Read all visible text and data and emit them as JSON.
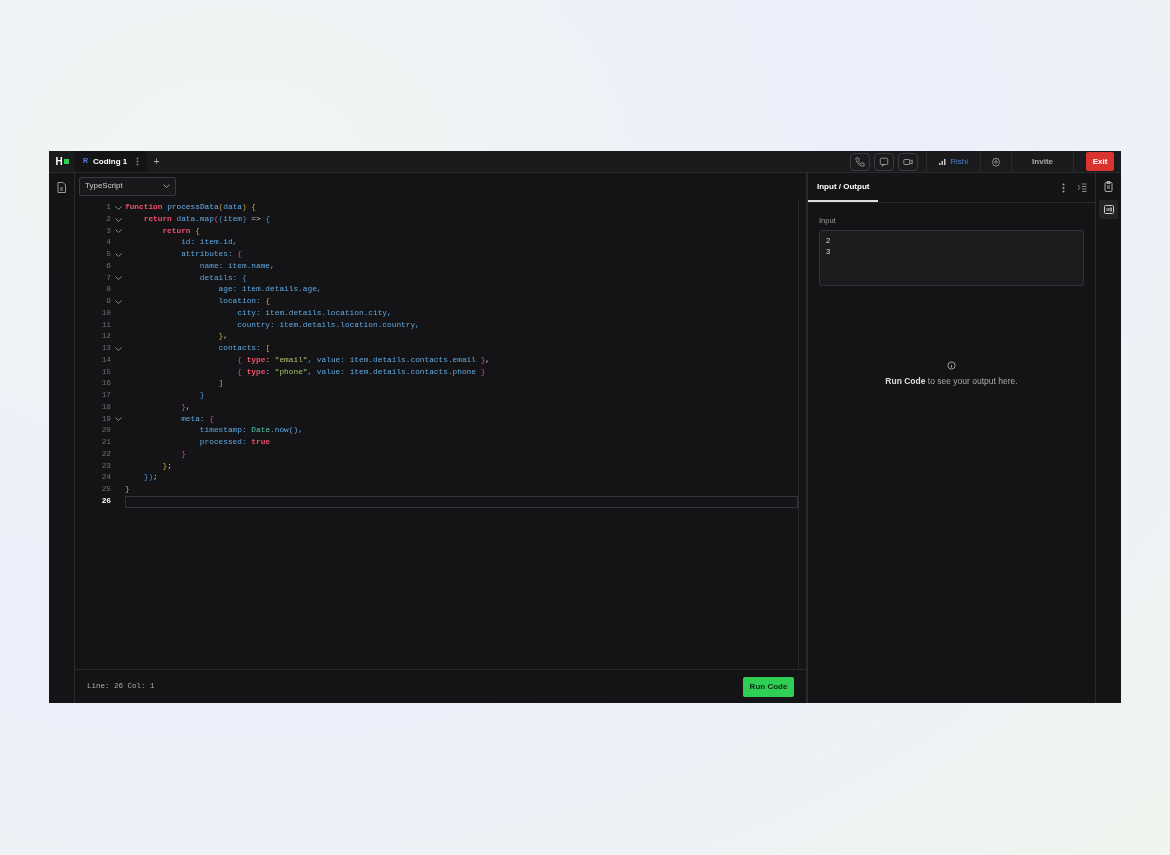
{
  "top_bar": {
    "logo": "H",
    "tabs": [
      {
        "badge": "R",
        "label": "Coding 1",
        "selected": true
      }
    ],
    "add_tab": "+",
    "user": "Rishi",
    "invite": "Invite",
    "exit": "Exit"
  },
  "editor": {
    "language": "TypeScript",
    "lines": [
      {
        "n": "1",
        "fold": true,
        "current": false,
        "seg": [
          {
            "text": "function ",
            "kind": "k"
          },
          {
            "text": "processData",
            "kind": "f"
          },
          {
            "text": "(",
            "kind": "y"
          },
          {
            "text": "data",
            "kind": "i"
          },
          {
            "text": ") {",
            "kind": "y"
          }
        ]
      },
      {
        "n": "2",
        "fold": true,
        "current": false,
        "seg": [
          {
            "text": "    return ",
            "kind": "k"
          },
          {
            "text": "data.map",
            "kind": "i"
          },
          {
            "text": "(",
            "kind": "m"
          },
          {
            "text": "(",
            "kind": "b"
          },
          {
            "text": "item",
            "kind": "i"
          },
          {
            "text": ")",
            "kind": "b"
          },
          {
            "text": " => ",
            "kind": "p"
          },
          {
            "text": "{",
            "kind": "b"
          }
        ]
      },
      {
        "n": "3",
        "fold": true,
        "current": false,
        "seg": [
          {
            "text": "        return ",
            "kind": "k"
          },
          {
            "text": "{",
            "kind": "y"
          }
        ]
      },
      {
        "n": "4",
        "fold": false,
        "current": false,
        "seg": [
          {
            "text": "            id: item.id,",
            "kind": "i"
          }
        ]
      },
      {
        "n": "5",
        "fold": true,
        "current": false,
        "seg": [
          {
            "text": "            attributes: ",
            "kind": "i"
          },
          {
            "text": "{",
            "kind": "m"
          }
        ]
      },
      {
        "n": "6",
        "fold": false,
        "current": false,
        "seg": [
          {
            "text": "                name: item.name,",
            "kind": "i"
          }
        ]
      },
      {
        "n": "7",
        "fold": true,
        "current": false,
        "seg": [
          {
            "text": "                details: ",
            "kind": "i"
          },
          {
            "text": "{",
            "kind": "b"
          }
        ]
      },
      {
        "n": "8",
        "fold": false,
        "current": false,
        "seg": [
          {
            "text": "                    age: item.details.age,",
            "kind": "i"
          }
        ]
      },
      {
        "n": "9",
        "fold": true,
        "current": false,
        "seg": [
          {
            "text": "                    location: ",
            "kind": "i"
          },
          {
            "text": "{",
            "kind": "y"
          }
        ]
      },
      {
        "n": "10",
        "fold": false,
        "current": false,
        "seg": [
          {
            "text": "                        city: item.details.location.city,",
            "kind": "i"
          }
        ]
      },
      {
        "n": "11",
        "fold": false,
        "current": false,
        "seg": [
          {
            "text": "                        country: item.details.location.country,",
            "kind": "i"
          }
        ]
      },
      {
        "n": "12",
        "fold": false,
        "current": false,
        "seg": [
          {
            "text": "                    }",
            "kind": "y"
          },
          {
            "text": ",",
            "kind": "p"
          }
        ]
      },
      {
        "n": "13",
        "fold": true,
        "current": false,
        "seg": [
          {
            "text": "                    contacts: ",
            "kind": "i"
          },
          {
            "text": "[",
            "kind": "y"
          }
        ]
      },
      {
        "n": "14",
        "fold": false,
        "current": false,
        "seg": [
          {
            "text": "                        {",
            "kind": "m"
          },
          {
            "text": " type",
            "kind": "k"
          },
          {
            "text": ": ",
            "kind": "p"
          },
          {
            "text": "\"email\"",
            "kind": "s"
          },
          {
            "text": ", value: item.details.contacts.email ",
            "kind": "i"
          },
          {
            "text": "}",
            "kind": "m"
          },
          {
            "text": ",",
            "kind": "p"
          }
        ]
      },
      {
        "n": "15",
        "fold": false,
        "current": false,
        "seg": [
          {
            "text": "                        {",
            "kind": "m"
          },
          {
            "text": " type",
            "kind": "k"
          },
          {
            "text": ": ",
            "kind": "p"
          },
          {
            "text": "\"phone\"",
            "kind": "s"
          },
          {
            "text": ", value: item.details.contacts.phone ",
            "kind": "i"
          },
          {
            "text": "}",
            "kind": "m"
          }
        ]
      },
      {
        "n": "16",
        "fold": false,
        "current": false,
        "seg": [
          {
            "text": "                    ]",
            "kind": "y"
          }
        ]
      },
      {
        "n": "17",
        "fold": false,
        "current": false,
        "seg": [
          {
            "text": "                }",
            "kind": "b"
          }
        ]
      },
      {
        "n": "18",
        "fold": false,
        "current": false,
        "seg": [
          {
            "text": "            }",
            "kind": "m"
          },
          {
            "text": ",",
            "kind": "p"
          }
        ]
      },
      {
        "n": "19",
        "fold": true,
        "current": false,
        "seg": [
          {
            "text": "            meta: ",
            "kind": "i"
          },
          {
            "text": "{",
            "kind": "m"
          }
        ]
      },
      {
        "n": "20",
        "fold": false,
        "current": false,
        "seg": [
          {
            "text": "                timestamp: ",
            "kind": "i"
          },
          {
            "text": "Date",
            "kind": "t"
          },
          {
            "text": ".now(),",
            "kind": "i"
          }
        ]
      },
      {
        "n": "21",
        "fold": false,
        "current": false,
        "seg": [
          {
            "text": "                processed: ",
            "kind": "i"
          },
          {
            "text": "true",
            "kind": "k"
          }
        ]
      },
      {
        "n": "22",
        "fold": false,
        "current": false,
        "seg": [
          {
            "text": "            }",
            "kind": "m"
          }
        ]
      },
      {
        "n": "23",
        "fold": false,
        "current": false,
        "seg": [
          {
            "text": "        }",
            "kind": "y"
          },
          {
            "text": ";",
            "kind": "p"
          }
        ]
      },
      {
        "n": "24",
        "fold": false,
        "current": false,
        "seg": [
          {
            "text": "    })",
            "kind": "b"
          },
          {
            "text": ";",
            "kind": "p"
          }
        ]
      },
      {
        "n": "25",
        "fold": false,
        "current": false,
        "seg": [
          {
            "text": "}",
            "kind": "y"
          }
        ]
      },
      {
        "n": "26",
        "fold": false,
        "current": true
      }
    ],
    "status": "Line: 26 Col: 1",
    "run_button": "Run Code"
  },
  "panel": {
    "tabs": [
      {
        "label": "Input / Output",
        "selected": true
      }
    ],
    "input_label": "Input",
    "input_value": "2\n3",
    "empty_message": "**Run Code** to see your output here."
  }
}
